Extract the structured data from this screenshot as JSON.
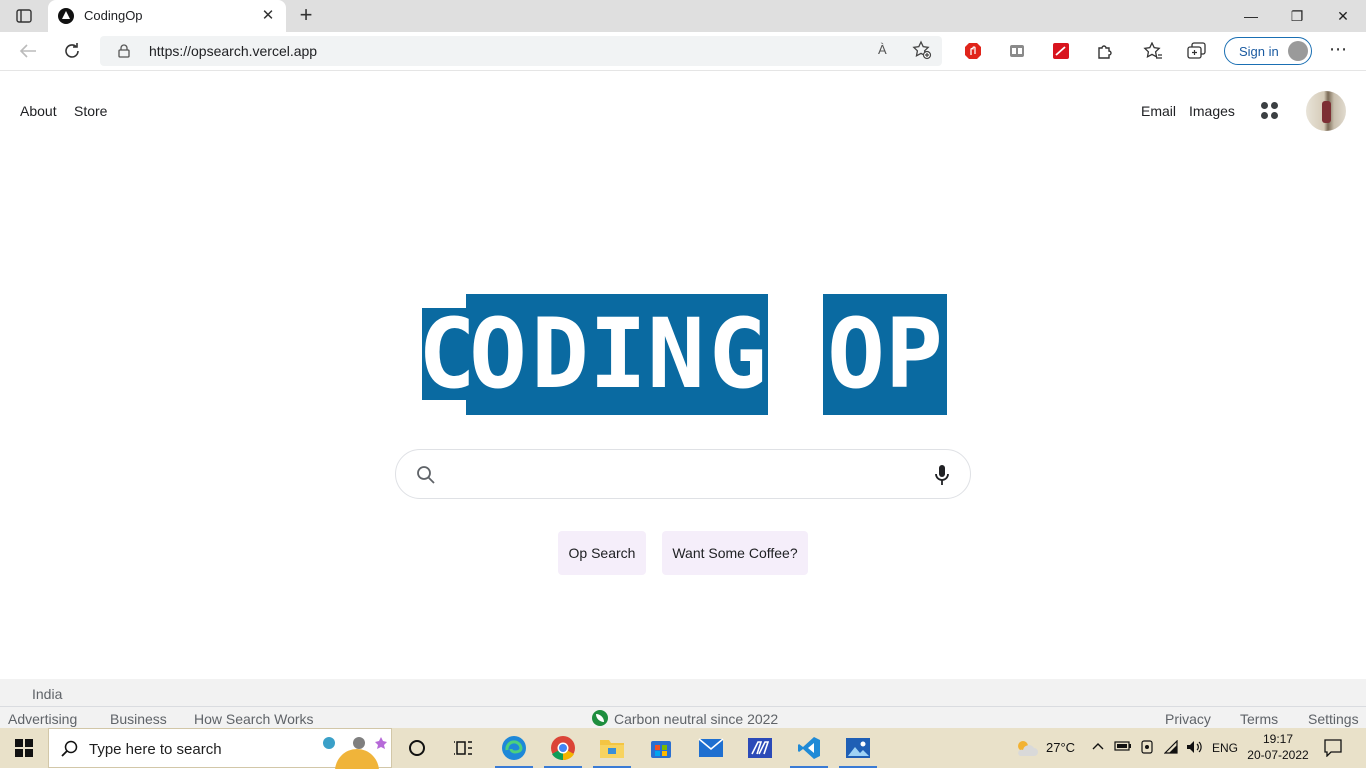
{
  "browser": {
    "tab_title": "CodingOp",
    "url": "https://opsearch.vercel.app",
    "sign_in_label": "Sign in",
    "read_aloud_label": "À"
  },
  "page": {
    "nav_left": [
      "About",
      "Store"
    ],
    "nav_right": [
      "Email",
      "Images"
    ],
    "logo_letters": [
      "C",
      "O",
      "D",
      "I",
      "N",
      "G",
      "O",
      "P"
    ],
    "search": {
      "value": "",
      "placeholder": ""
    },
    "buttons": [
      "Op Search",
      "Want Some Coffee?"
    ],
    "accent_color": "#0a6aa1"
  },
  "footer": {
    "country": "India",
    "left_links": [
      "Advertising",
      "Business",
      "How Search Works"
    ],
    "center_text": "Carbon neutral since 2022",
    "right_links": [
      "Privacy",
      "Terms",
      "Settings"
    ]
  },
  "taskbar": {
    "search_placeholder": "Type here to search",
    "weather": "27°C",
    "language": "ENG",
    "time": "19:17",
    "date": "20-07-2022"
  }
}
